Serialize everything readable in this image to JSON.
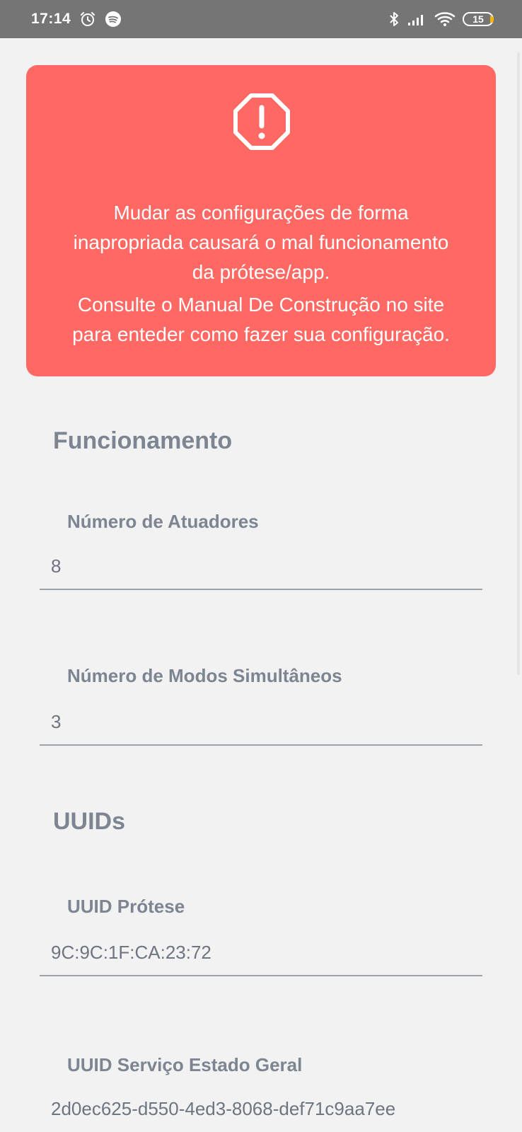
{
  "status_bar": {
    "time": "17:14",
    "left_icons": [
      "alarm-icon",
      "spotify-icon"
    ],
    "right_icons": [
      "bluetooth-icon",
      "signal-icon",
      "wifi-icon"
    ],
    "battery_level": "15",
    "battery_accent": "#f5b400"
  },
  "warning": {
    "color": "#ff6863",
    "icon": "alert-octagon-icon",
    "line1": "Mudar as configurações de forma inapropriada causará o mal funcionamento da prótese/app.",
    "line2": "Consulte o Manual De Construção no site para enteder como fazer sua configuração."
  },
  "sections": {
    "funcionamento": {
      "title": "Funcionamento",
      "fields": [
        {
          "label": "Número de Atuadores",
          "value": "8"
        },
        {
          "label": "Número de Modos Simultâneos",
          "value": "3"
        }
      ]
    },
    "uuids": {
      "title": "UUIDs",
      "fields": [
        {
          "label": "UUID Prótese",
          "value": "9C:9C:1F:CA:23:72"
        },
        {
          "label": "UUID Serviço Estado Geral",
          "value": "2d0ec625-d550-4ed3-8068-def71c9aa7ee"
        }
      ]
    }
  },
  "colors": {
    "section_text": "#7c8591",
    "background": "#f2f2f2",
    "status_bar": "#757575"
  }
}
